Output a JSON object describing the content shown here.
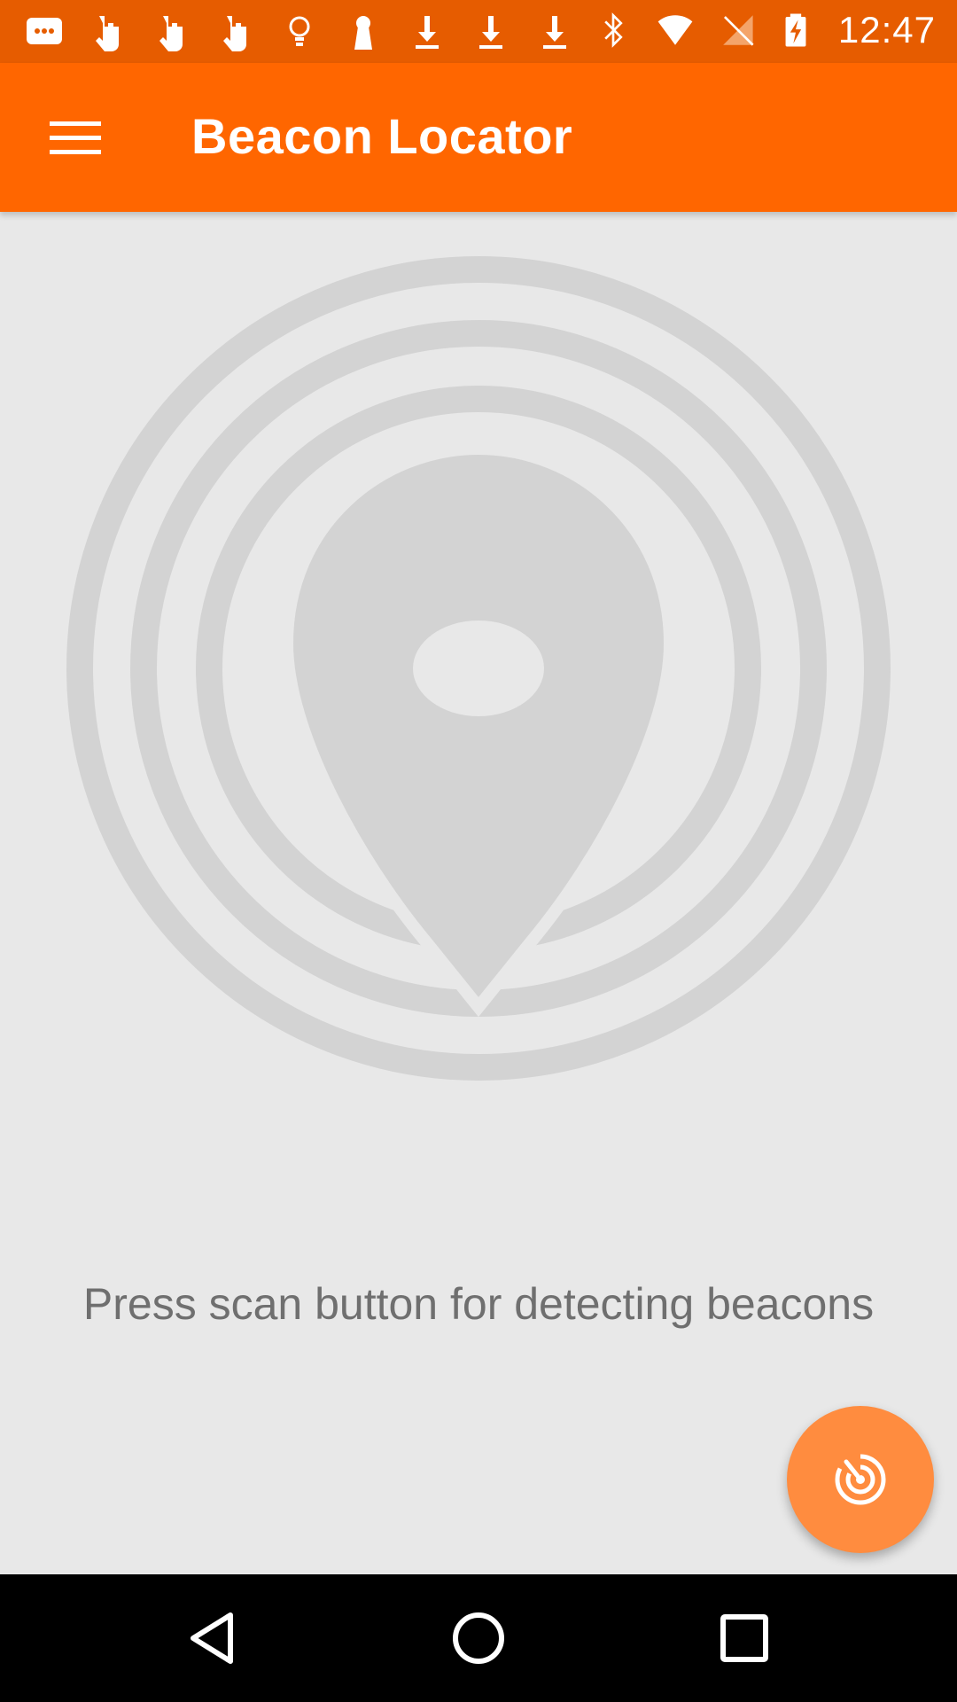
{
  "status_bar": {
    "time": "12:47",
    "left_icons": [
      "message-icon",
      "hand-icon",
      "hand-icon",
      "hand-icon",
      "lightbulb-icon",
      "keyhole-icon",
      "download-icon",
      "download-icon",
      "download-icon"
    ],
    "right_icons": [
      "bluetooth-icon",
      "wifi-icon",
      "no-signal-icon",
      "battery-charging-icon"
    ],
    "color": "#e65c00"
  },
  "app_bar": {
    "title": "Beacon Locator",
    "color": "#ff6600"
  },
  "main": {
    "hint": "Press scan button for detecting beacons",
    "illustration_color": "#d3d3d3"
  },
  "fab": {
    "icon": "radar-scan-icon",
    "color": "#ff8c3f"
  },
  "nav_bar": {
    "buttons": [
      "back-icon",
      "home-icon",
      "recents-icon"
    ]
  }
}
